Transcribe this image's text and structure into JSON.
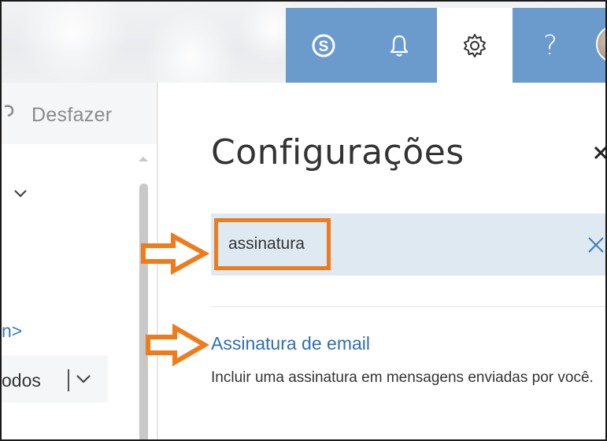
{
  "topbar": {
    "buttons": [
      {
        "icon": "skype-icon"
      },
      {
        "icon": "bell-icon"
      },
      {
        "icon": "gear-icon"
      },
      {
        "icon": "help-icon",
        "label": "?"
      }
    ]
  },
  "left_pane": {
    "undo_label": "Desfazer",
    "link_partial": "n>",
    "filter_label": "odos"
  },
  "settings": {
    "title": "Configurações",
    "search_value": "assinatura",
    "result": {
      "title": "Assinatura de email",
      "description": "Incluir uma assinatura em mensagens enviadas por você."
    }
  },
  "colors": {
    "topbar_blue": "#6b9bcc",
    "search_bg": "#dfe9f2",
    "highlight_orange": "#f07b1c",
    "link_blue": "#2e6fae"
  }
}
